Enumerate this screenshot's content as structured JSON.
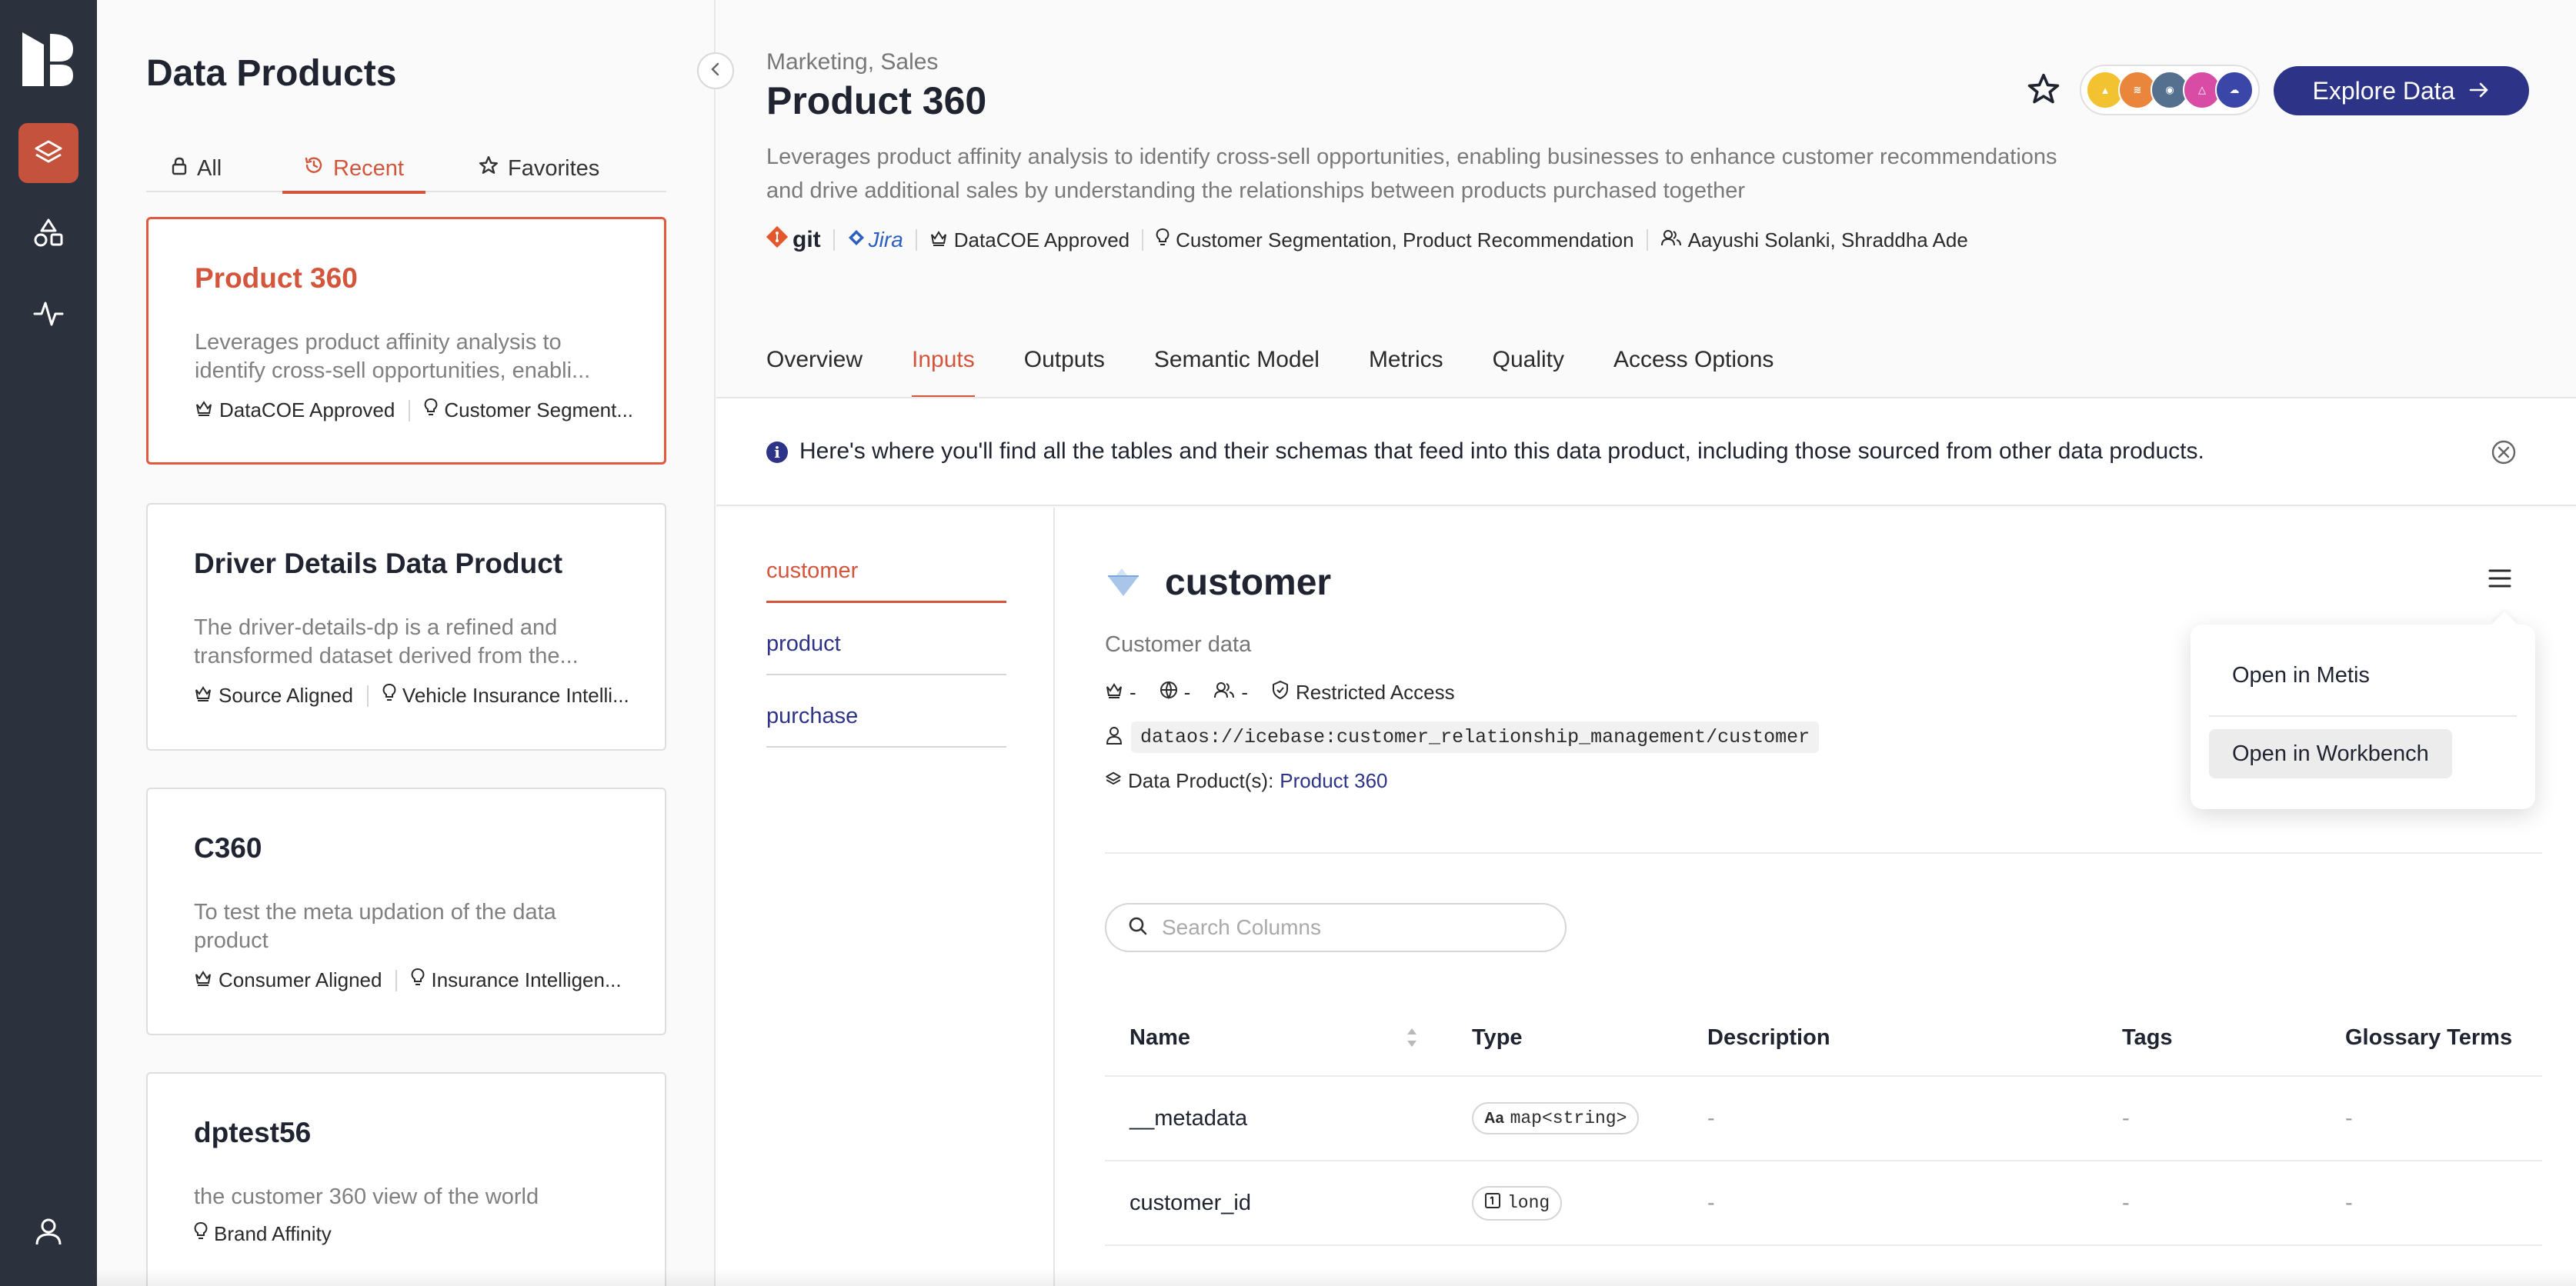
{
  "rail": {
    "items": [
      "data-products",
      "shapes",
      "activity",
      "profile"
    ]
  },
  "list": {
    "title": "Data Products",
    "tabs": [
      {
        "label": "All",
        "icon": "lock-icon"
      },
      {
        "label": "Recent",
        "icon": "history-icon"
      },
      {
        "label": "Favorites",
        "icon": "star-icon"
      }
    ],
    "cards": [
      {
        "title": "Product 360",
        "desc": "Leverages product affinity analysis to identify cross-sell opportunities, enabli...",
        "tag1": "DataCOE Approved",
        "tag2": "Customer Segment..."
      },
      {
        "title": "Driver Details Data Product",
        "desc": "The driver-details-dp is a refined and transformed dataset derived from the...",
        "tag1": "Source Aligned",
        "tag2": "Vehicle Insurance Intelli..."
      },
      {
        "title": "C360",
        "desc": "To test the meta updation of the data product",
        "tag1": "Consumer Aligned",
        "tag2": "Insurance Intelligen..."
      },
      {
        "title": "dptest56",
        "desc": "the customer 360 view of the world",
        "tag1": "",
        "tag2": "Brand Affinity"
      }
    ]
  },
  "product": {
    "crumb": "Marketing, Sales",
    "title": "Product 360",
    "desc": "Leverages product affinity analysis to identify cross-sell opportunities, enabling businesses to enhance customer recommendations and drive additional sales by understanding the relationships between products purchased together",
    "git": "git",
    "jira": "Jira",
    "approval": "DataCOE Approved",
    "use_cases": "Customer Segmentation, Product Recommendation",
    "owners": "Aayushi Solanki, Shraddha Ade",
    "explore_label": "Explore Data",
    "source_icons": [
      "source-icon-1",
      "source-icon-2",
      "source-icon-3",
      "source-icon-4",
      "source-icon-5"
    ]
  },
  "tabs": [
    "Overview",
    "Inputs",
    "Outputs",
    "Semantic Model",
    "Metrics",
    "Quality",
    "Access Options"
  ],
  "info": "Here's where you'll find all the tables and their schemas that feed into this data product, including those sourced from other data products.",
  "datasets": [
    "customer",
    "product",
    "purchase"
  ],
  "table": {
    "name": "customer",
    "desc": "Customer data",
    "m1": "-",
    "m2": "-",
    "m3": "-",
    "access": "Restricted Access",
    "path": "dataos://icebase:customer_relationship_management/customer",
    "dp_label": "Data Product(s):",
    "dp_link": "Product 360",
    "search_placeholder": "Search Columns",
    "columns": [
      "Name",
      "Type",
      "Description",
      "Tags",
      "Glossary Terms"
    ],
    "rows": [
      {
        "name": "__metadata",
        "type": "map<string>",
        "desc": "-",
        "tags": "-",
        "glossary": "-"
      },
      {
        "name": "customer_id",
        "type": "long",
        "desc": "-",
        "tags": "-",
        "glossary": "-"
      }
    ]
  },
  "menu": {
    "item1": "Open in Metis",
    "item2": "Open in Workbench"
  },
  "colors": {
    "accent": "#d2553c",
    "primary": "#2d3386",
    "rail": "#2b323d"
  }
}
